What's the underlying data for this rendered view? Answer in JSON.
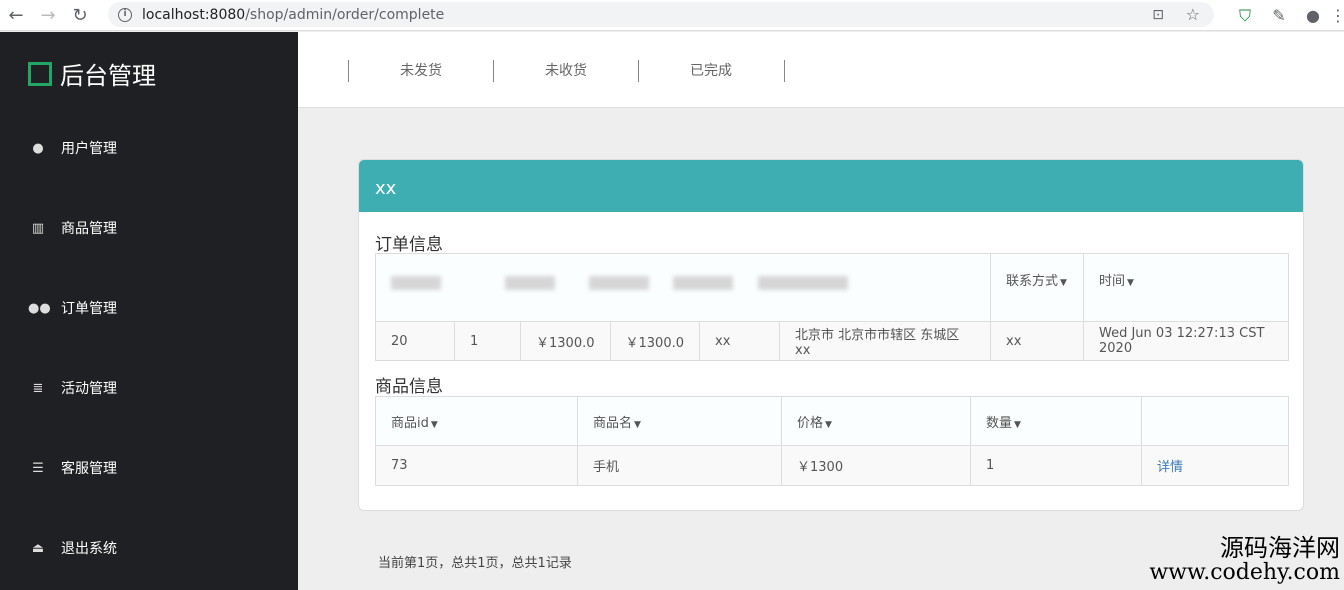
{
  "browser": {
    "url_host": "localhost:8080",
    "url_path": "/shop/admin/order/complete"
  },
  "sidebar": {
    "title": "后台管理",
    "items": [
      {
        "label": "用户管理",
        "icon": "user-icon"
      },
      {
        "label": "商品管理",
        "icon": "bar-chart-icon"
      },
      {
        "label": "订单管理",
        "icon": "users-icon"
      },
      {
        "label": "活动管理",
        "icon": "database-icon"
      },
      {
        "label": "客服管理",
        "icon": "sliders-icon"
      },
      {
        "label": "退出系统",
        "icon": "eject-icon"
      }
    ]
  },
  "tabs": [
    "未发货",
    "未收货",
    "已完成"
  ],
  "panel": {
    "title": "xx",
    "order_section": "订单信息",
    "order_headers": [
      "联系方式",
      "时间"
    ],
    "order_row": [
      "20",
      "1",
      "￥1300.0",
      "￥1300.0",
      "xx",
      "北京市 北京市市辖区 东城区 xx",
      "xx",
      "Wed Jun 03 12:27:13 CST 2020"
    ],
    "goods_section": "商品信息",
    "goods_headers": [
      "商品id",
      "商品名",
      "价格",
      "数量",
      ""
    ],
    "goods_row": [
      "73",
      "手机",
      "￥1300",
      "1",
      "详情"
    ]
  },
  "pager": "当前第1页，总共1页，总共1记录",
  "watermark": {
    "cn": "源码海洋网",
    "url": "www.codehy.com"
  }
}
